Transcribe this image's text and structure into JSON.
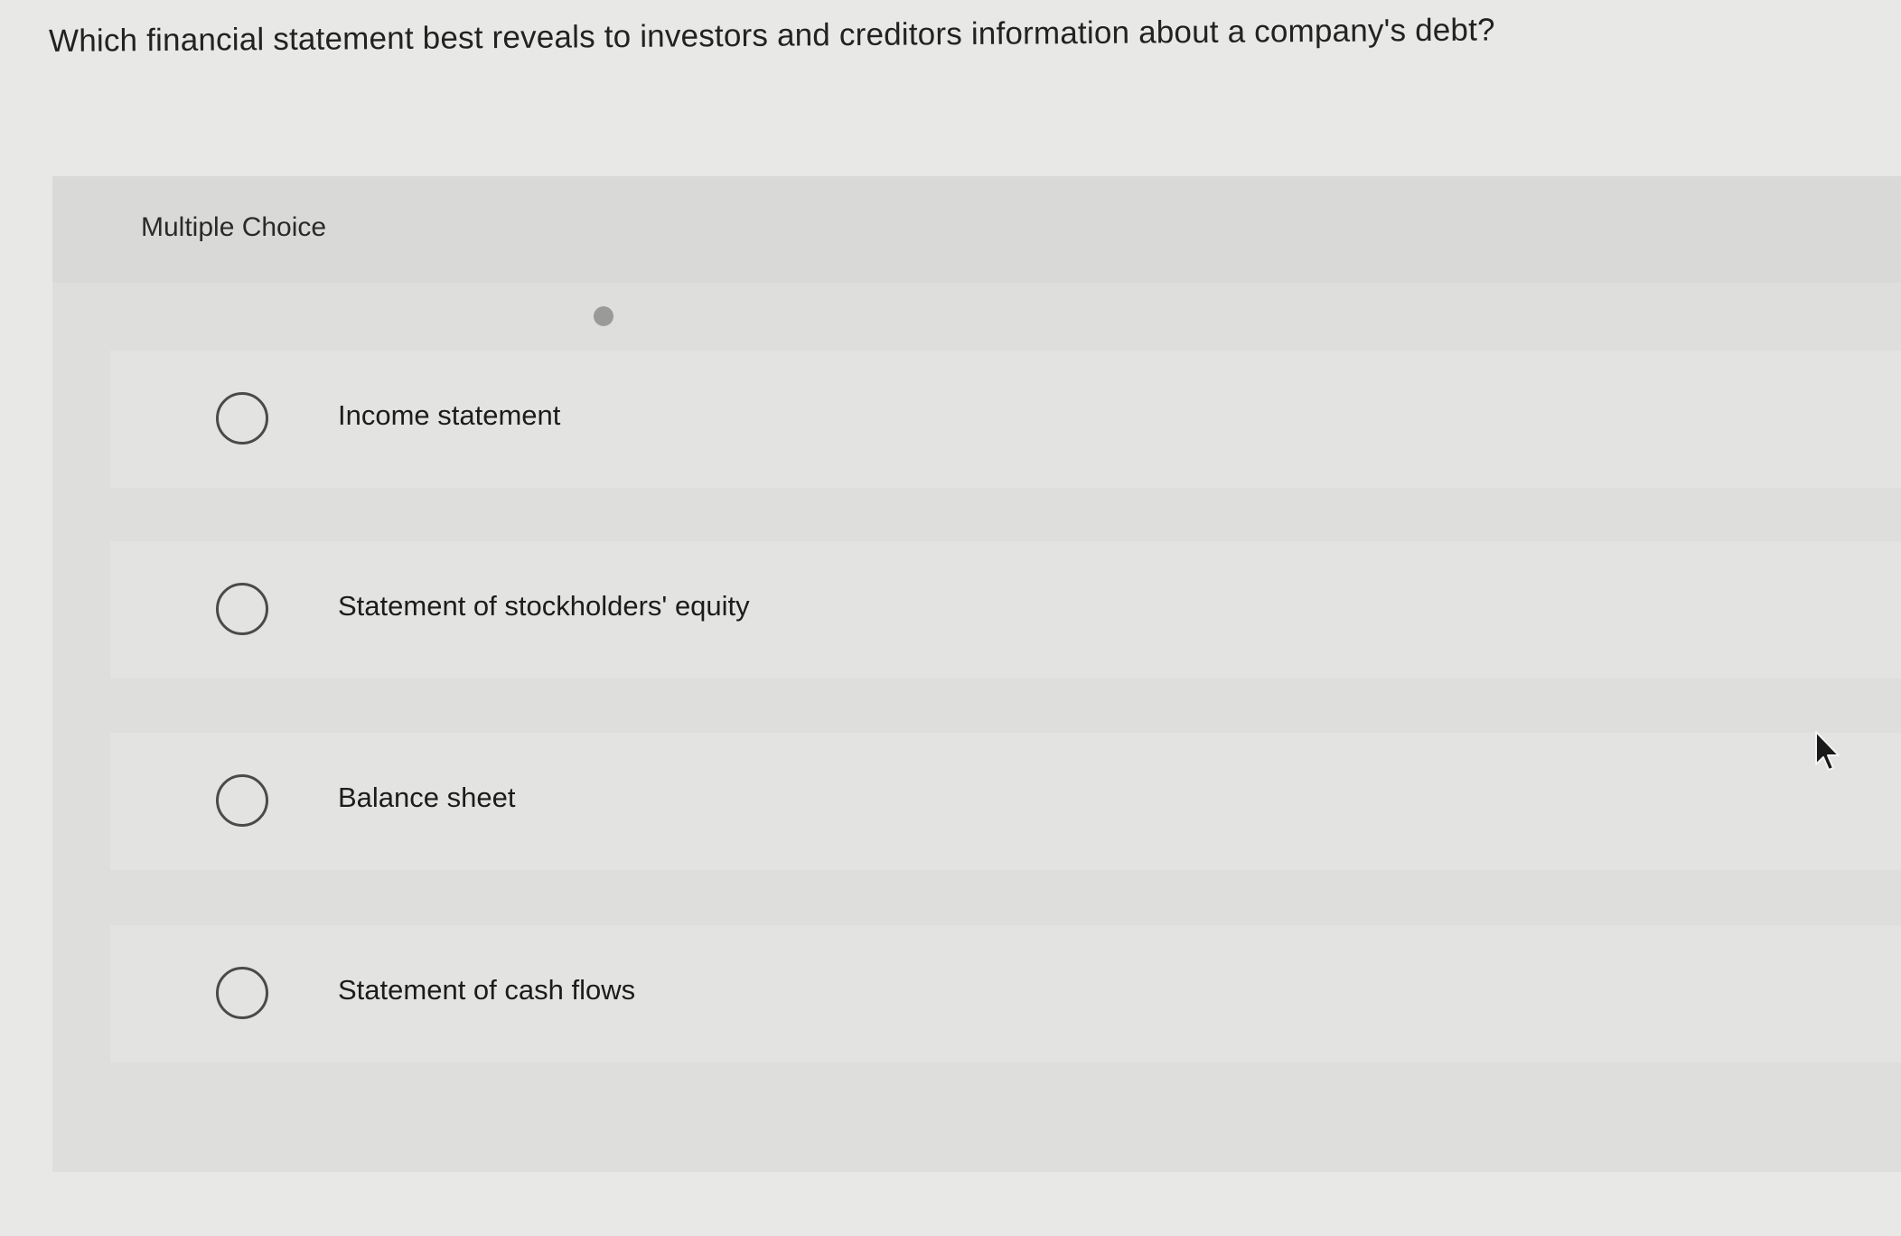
{
  "question": {
    "text": "Which financial statement best reveals to investors and creditors information about a company's debt?"
  },
  "panel": {
    "title": "Multiple Choice"
  },
  "options": [
    {
      "label": "Income statement",
      "selected": false
    },
    {
      "label": "Statement of stockholders' equity",
      "selected": false
    },
    {
      "label": "Balance sheet",
      "selected": false
    },
    {
      "label": "Statement of cash flows",
      "selected": false
    }
  ],
  "icons": {
    "pointer": "mouse-cursor-icon"
  },
  "colors": {
    "page_background": "#e8e8e6",
    "panel_background": "#dededc",
    "option_background": "#e3e3e1",
    "radio_border": "#4a4a4a"
  }
}
